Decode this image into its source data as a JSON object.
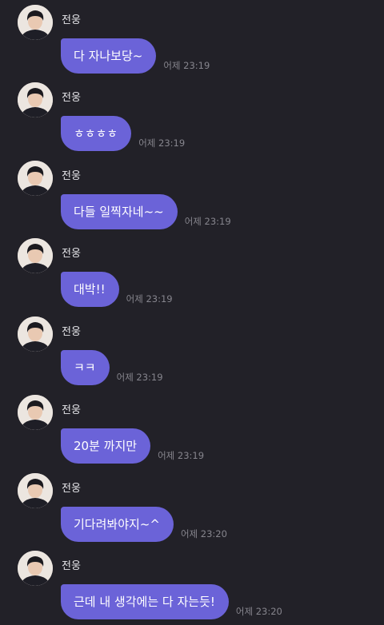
{
  "messages": [
    {
      "sender": "전웅",
      "text": "다 자나보당~",
      "time": "어제 23:19"
    },
    {
      "sender": "전웅",
      "text": "ㅎㅎㅎㅎ",
      "time": "어제 23:19"
    },
    {
      "sender": "전웅",
      "text": "다들 일찍자네~~",
      "time": "어제 23:19"
    },
    {
      "sender": "전웅",
      "text": "대박!!",
      "time": "어제 23:19"
    },
    {
      "sender": "전웅",
      "text": "ㅋㅋ",
      "time": "어제 23:19"
    },
    {
      "sender": "전웅",
      "text": "20분 까지만",
      "time": "어제 23:19"
    },
    {
      "sender": "전웅",
      "text": "기다려봐야지~^",
      "time": "어제 23:20"
    },
    {
      "sender": "전웅",
      "text": "근데 내 생각에는 다 자는듯!",
      "time": "어제 23:20"
    }
  ],
  "colors": {
    "background": "#222128",
    "bubble": "#6b63d8",
    "time_text": "#86858d"
  }
}
